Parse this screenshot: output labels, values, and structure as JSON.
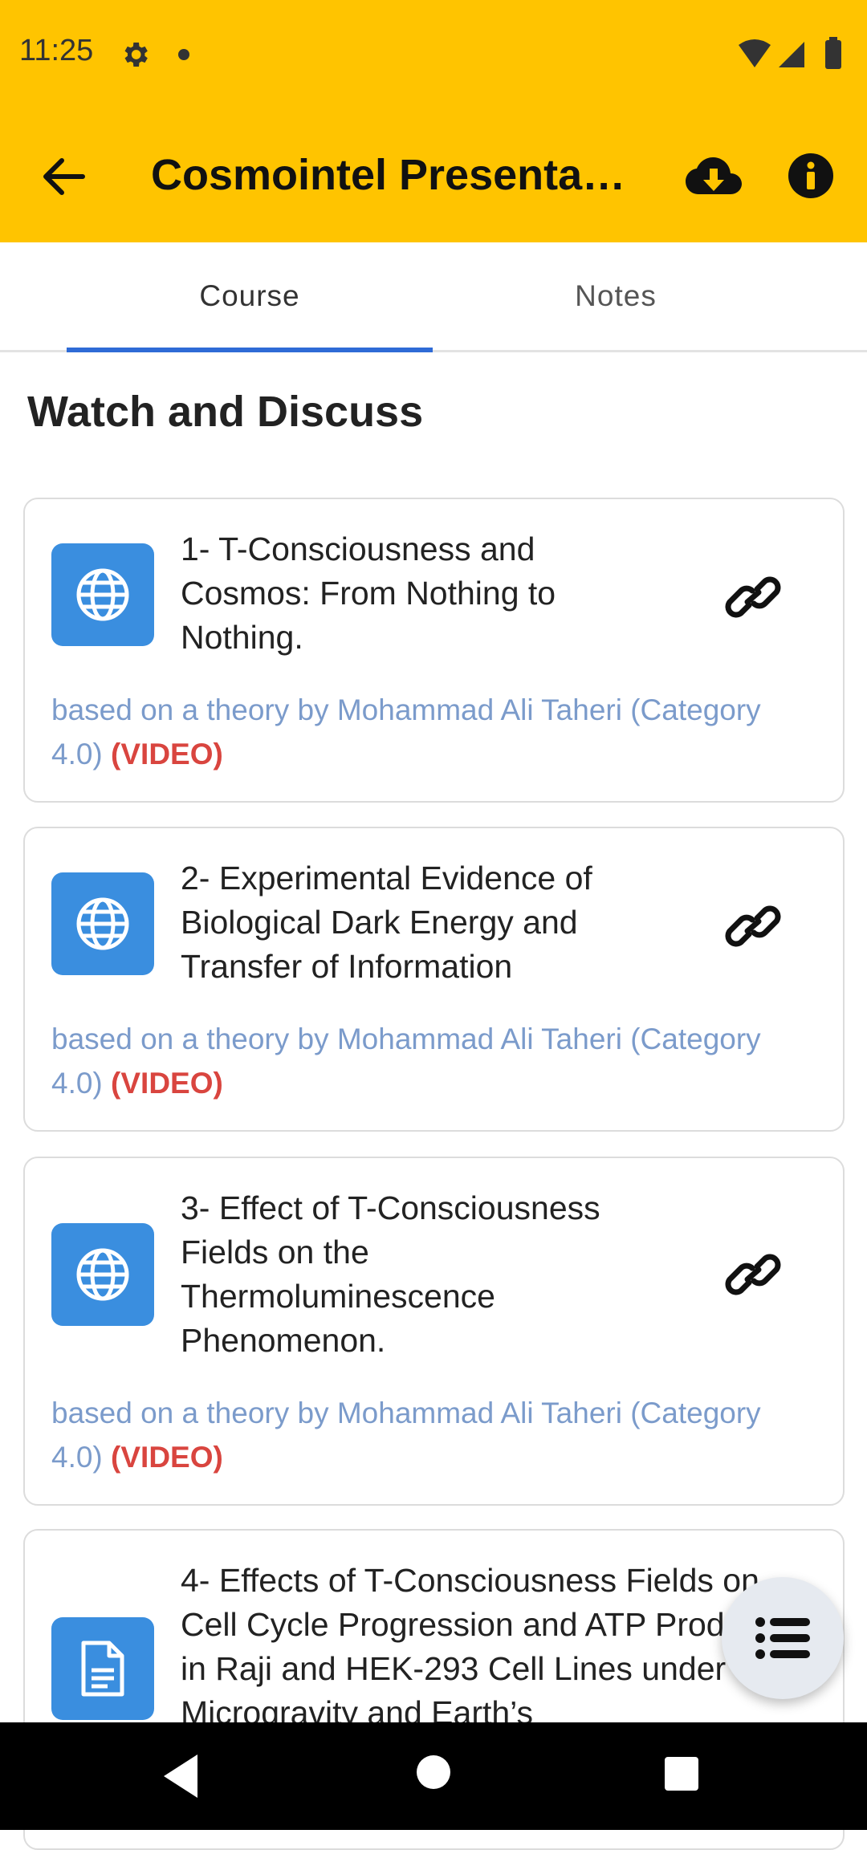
{
  "status_bar": {
    "time": "11:25"
  },
  "app_bar": {
    "title": "Cosmointel Presentat…"
  },
  "tabs": [
    {
      "label": "Course",
      "selected": true
    },
    {
      "label": "Notes",
      "selected": false
    }
  ],
  "section": {
    "title": "Watch and Discuss"
  },
  "items": [
    {
      "title": "1- T-Consciousness and Cosmos: From Nothing to Nothing.",
      "meta": "based on a theory by Mohammad Ali Taheri (Category 4.0)",
      "tag": "(VIDEO)",
      "icon": "globe-icon"
    },
    {
      "title": "2- Experimental Evidence of Biological Dark Energy and Transfer of Information",
      "meta": "based on a theory by Mohammad Ali Taheri (Category 4.0)",
      "tag": "(VIDEO)",
      "icon": "globe-icon"
    },
    {
      "title": "3- Effect of T-Consciousness Fields on the Thermoluminescence Phenomenon.",
      "meta": "based on a theory by Mohammad Ali Taheri (Category 4.0)",
      "tag": "(VIDEO)",
      "icon": "globe-icon"
    },
    {
      "title": "4- Effects of T-Consciousness Fields on Cell Cycle Progression and ATP Production in Raji and HEK-293 Cell Lines under Microgravity and Earth’s",
      "icon": "document-icon"
    }
  ],
  "colors": {
    "accent": "#FFC400",
    "tab_indicator": "#2F6BD6",
    "icon_tile": "#3A8EDF",
    "meta_text": "#7B9BCB",
    "video_tag": "#D9453F"
  }
}
